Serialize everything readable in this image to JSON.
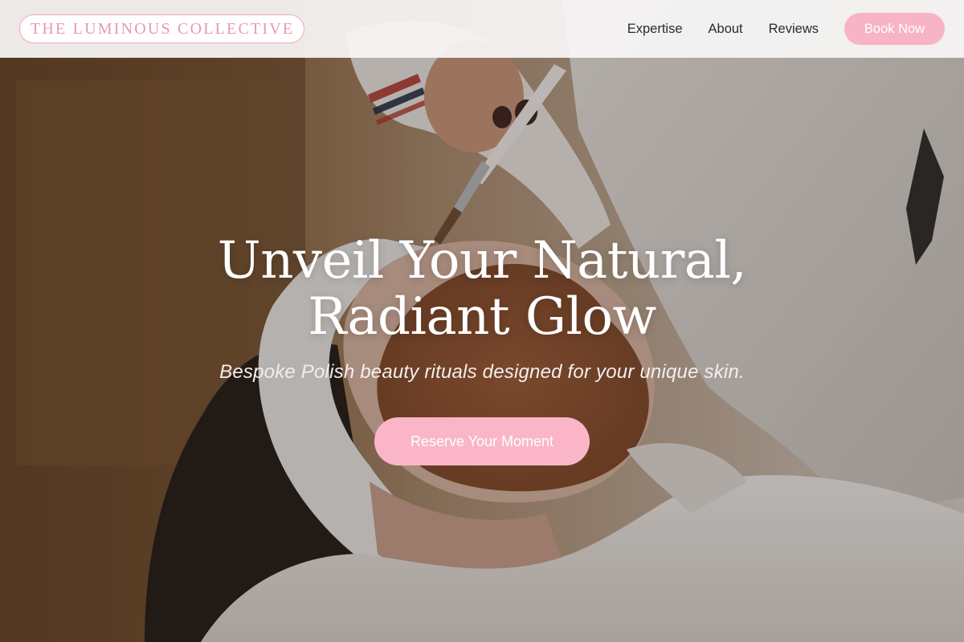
{
  "header": {
    "logo_text": "THE LUMINOUS COLLECTIVE",
    "nav": [
      {
        "label": "Expertise"
      },
      {
        "label": "About"
      },
      {
        "label": "Reviews"
      }
    ],
    "book_button": "Book Now"
  },
  "hero": {
    "title_line1": "Unveil Your Natural,",
    "title_line2": "Radiant Glow",
    "subtitle": "Bespoke Polish beauty rituals designed for your unique skin.",
    "cta": "Reserve Your Moment"
  },
  "colors": {
    "accent_pink": "#f8b3c7",
    "logo_pink": "#e79aae",
    "header_bg": "#f8f6f6",
    "text_dark": "#2b2b2b"
  },
  "icons": {
    "hero_image": "facial-treatment-photo"
  }
}
